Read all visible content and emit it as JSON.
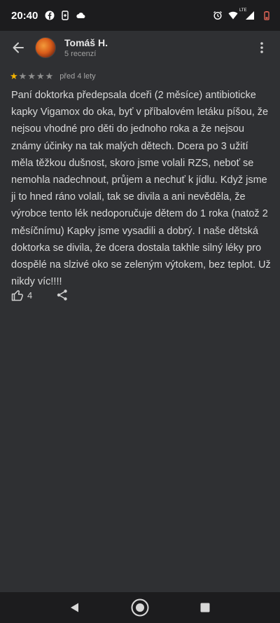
{
  "status_bar": {
    "time": "20:40",
    "left_icons": [
      "facebook-icon",
      "phone-usage-icon",
      "cloud-icon"
    ],
    "right_icons": [
      "alarm-icon",
      "wifi-icon",
      "lte-signal-icon",
      "battery-low-icon"
    ],
    "network_label": "LTE"
  },
  "header": {
    "back_icon": "arrow-back-icon",
    "user_name": "Tomáš H.",
    "review_count": "5 recenzí",
    "more_icon": "more-vertical-icon"
  },
  "review": {
    "rating": 1,
    "max_rating": 5,
    "date": "před 4 lety",
    "text": "Paní doktorka předepsala dceři (2 měsíce) antibioticke kapky Vigamox do oka, byť v příbalovém letáku píšou, že nejsou vhodné pro děti do jednoho roka a že nejsou známy účinky na tak malých dětech. Dcera po 3 užití měla těžkou dušnost, skoro jsme volali RZS, neboť se nemohla nadechnout, průjem a nechuť k jídlu. Když jsme ji to hned ráno volali, tak se divila a ani nevěděla, že výrobce tento lék nedoporučuje dětem do 1 roka (natož 2 měsíčnímu) Kapky jsme vysadili a dobrý. I naše dětská doktorka se divila, že dcera dostala takhle silný léky pro dospělé na slzivé oko se zeleným výtokem, bez teplot. Už nikdy víc!!!!"
  },
  "actions": {
    "like_icon": "thumbs-up-icon",
    "like_count": "4",
    "share_icon": "share-icon"
  },
  "nav_bar": {
    "buttons": [
      "back-triangle-icon",
      "home-circle-icon",
      "recents-square-icon"
    ]
  },
  "colors": {
    "background": "#2f3033",
    "star_filled": "#f5b400",
    "star_empty": "#8e8e8e",
    "text": "#d9d9d9"
  }
}
